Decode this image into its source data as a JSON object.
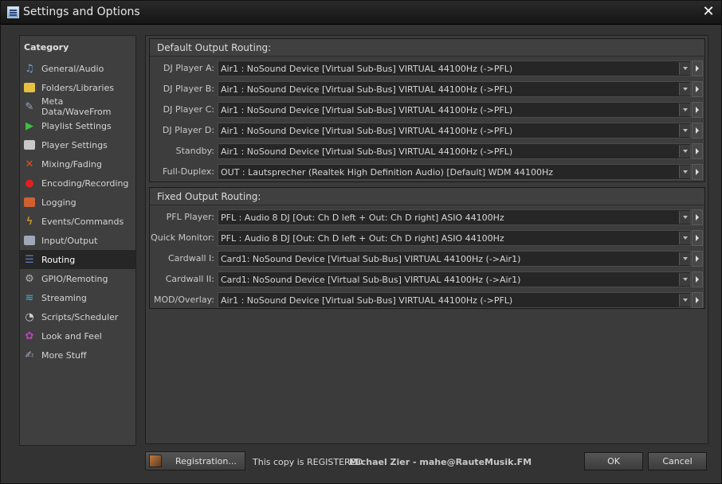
{
  "window": {
    "title": "Settings and Options"
  },
  "sidebar": {
    "title": "Category",
    "items": [
      {
        "label": "General/Audio",
        "icon": "music-note-icon",
        "color": "#6aa0e0"
      },
      {
        "label": "Folders/Libraries",
        "icon": "folder-icon",
        "color": "#e8c040"
      },
      {
        "label": "Meta Data/WaveFrom",
        "icon": "tags-icon",
        "color": "#9aa8c0"
      },
      {
        "label": "Playlist Settings",
        "icon": "play-icon",
        "color": "#3cc040"
      },
      {
        "label": "Player Settings",
        "icon": "player-deck-icon",
        "color": "#c8c8c8"
      },
      {
        "label": "Mixing/Fading",
        "icon": "crossfade-icon",
        "color": "#e05030"
      },
      {
        "label": "Encoding/Recording",
        "icon": "record-icon",
        "color": "#e02020"
      },
      {
        "label": "Logging",
        "icon": "logbook-icon",
        "color": "#d06030"
      },
      {
        "label": "Events/Commands",
        "icon": "lightning-icon",
        "color": "#f0b020"
      },
      {
        "label": "Input/Output",
        "icon": "io-port-icon",
        "color": "#a0a8b8"
      },
      {
        "label": "Routing",
        "icon": "routing-icon",
        "color": "#6080c0"
      },
      {
        "label": "GPIO/Remoting",
        "icon": "gpio-icon",
        "color": "#b0b0b0"
      },
      {
        "label": "Streaming",
        "icon": "streaming-icon",
        "color": "#40b0e0"
      },
      {
        "label": "Scripts/Scheduler",
        "icon": "clock-icon",
        "color": "#d0d0d0"
      },
      {
        "label": "Look and Feel",
        "icon": "color-palette-icon",
        "color": "#c040c0"
      },
      {
        "label": "More Stuff",
        "icon": "edit-document-icon",
        "color": "#a0a0c8"
      }
    ],
    "selected_index": 10
  },
  "default_routing": {
    "title": "Default Output Routing:",
    "rows": [
      {
        "label": "DJ Player A:",
        "value": "Air1 : NoSound Device [Virtual Sub-Bus] VIRTUAL 44100Hz (->PFL)"
      },
      {
        "label": "DJ Player B:",
        "value": "Air1 : NoSound Device [Virtual Sub-Bus] VIRTUAL 44100Hz (->PFL)"
      },
      {
        "label": "DJ Player C:",
        "value": "Air1 : NoSound Device [Virtual Sub-Bus] VIRTUAL 44100Hz (->PFL)"
      },
      {
        "label": "DJ Player D:",
        "value": "Air1 : NoSound Device [Virtual Sub-Bus] VIRTUAL 44100Hz (->PFL)"
      },
      {
        "label": "Standby:",
        "value": "Air1 : NoSound Device [Virtual Sub-Bus] VIRTUAL 44100Hz (->PFL)"
      },
      {
        "label": "Full-Duplex:",
        "value": "OUT : Lautsprecher (Realtek High Definition Audio) [Default] WDM 44100Hz"
      }
    ]
  },
  "fixed_routing": {
    "title": "Fixed Output Routing:",
    "rows": [
      {
        "label": "PFL Player:",
        "value": "PFL : Audio 8 DJ [Out: Ch D left + Out: Ch D right] ASIO 44100Hz"
      },
      {
        "label": "Quick Monitor:",
        "value": "PFL : Audio 8 DJ [Out: Ch D left + Out: Ch D right] ASIO 44100Hz"
      },
      {
        "label": "Cardwall I:",
        "value": "Card1: NoSound Device [Virtual Sub-Bus] VIRTUAL 44100Hz (->Air1)"
      },
      {
        "label": "Cardwall II:",
        "value": "Card1: NoSound Device [Virtual Sub-Bus] VIRTUAL 44100Hz (->Air1)"
      },
      {
        "label": "MOD/Overlay:",
        "value": "Air1 : NoSound Device [Virtual Sub-Bus] VIRTUAL 44100Hz (->PFL)"
      }
    ]
  },
  "footer": {
    "registration_label": "Registration...",
    "registered_text": "This copy is REGISTERED",
    "registered_name": "Michael Zier - mahe@RauteMusik.FM",
    "ok_label": "OK",
    "cancel_label": "Cancel"
  }
}
